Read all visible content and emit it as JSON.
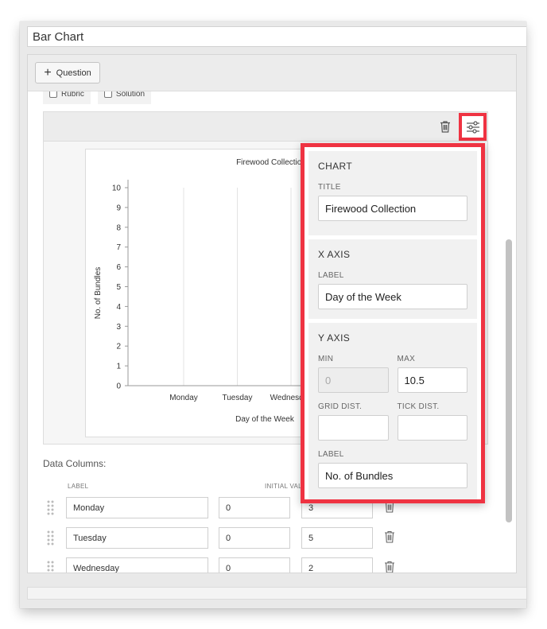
{
  "document": {
    "title": "Bar Chart"
  },
  "toolbar": {
    "add_question_label": "Question"
  },
  "options": [
    {
      "label": "Rubric"
    },
    {
      "label": "Solution"
    }
  ],
  "chart_data": {
    "type": "bar",
    "title": "Firewood Collection",
    "xlabel": "Day of the Week",
    "ylabel": "No. of Bundles",
    "categories": [
      "Monday",
      "Tuesday",
      "Wednesday"
    ],
    "ylim": [
      0,
      10
    ],
    "yticks": [
      "0",
      "1",
      "2",
      "3",
      "4",
      "5",
      "6",
      "7",
      "8",
      "9",
      "10"
    ],
    "grid": true
  },
  "data_columns": {
    "heading": "Data Columns:",
    "label_header": "LABEL",
    "initial_header": "INITIAL VAL",
    "rows": [
      {
        "label": "Monday",
        "initial": "0",
        "value": "3"
      },
      {
        "label": "Tuesday",
        "initial": "0",
        "value": "5"
      },
      {
        "label": "Wednesday",
        "initial": "0",
        "value": "2"
      }
    ]
  },
  "settings": {
    "chart": {
      "section_title": "CHART",
      "title_label": "TITLE",
      "title_value": "Firewood Collection"
    },
    "x_axis": {
      "section_title": "X AXIS",
      "label_label": "LABEL",
      "label_value": "Day of the Week"
    },
    "y_axis": {
      "section_title": "Y AXIS",
      "min_label": "MIN",
      "min_value": "0",
      "max_label": "MAX",
      "max_value": "10.5",
      "grid_label": "GRID DIST.",
      "grid_value": "",
      "tick_label": "TICK DIST.",
      "tick_value": "",
      "label_label": "LABEL",
      "label_value": "No. of Bundles"
    }
  },
  "colors": {
    "highlight": "#ef3342",
    "grid": "#e3e3e3"
  }
}
